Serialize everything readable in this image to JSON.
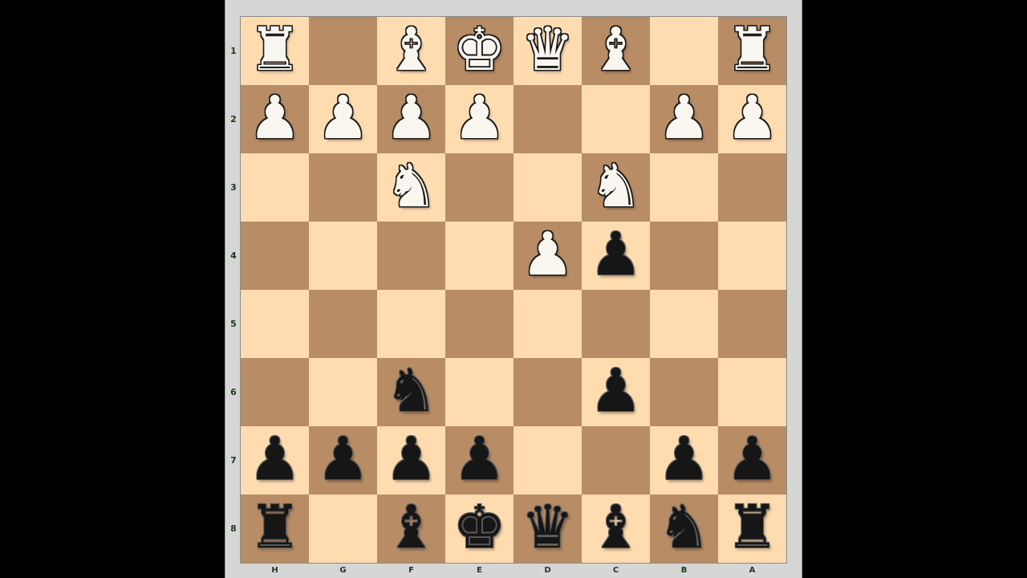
{
  "board": {
    "files": [
      "H",
      "G",
      "F",
      "E",
      "D",
      "C",
      "B",
      "A"
    ],
    "ranks": [
      "1",
      "2",
      "3",
      "4",
      "5",
      "6",
      "7",
      "8"
    ],
    "rows": [
      [
        "wr",
        "",
        "wb",
        "wk",
        "wq",
        "wb",
        "",
        "wr"
      ],
      [
        "wp",
        "wp",
        "wp",
        "wp",
        "",
        "",
        "wp",
        "wp"
      ],
      [
        "",
        "",
        "wn",
        "",
        "",
        "wn",
        "",
        ""
      ],
      [
        "",
        "",
        "",
        "",
        "wp",
        "bp",
        "",
        ""
      ],
      [
        "",
        "",
        "",
        "",
        "",
        "",
        "",
        ""
      ],
      [
        "",
        "",
        "bn",
        "",
        "",
        "bp",
        "",
        ""
      ],
      [
        "bp",
        "bp",
        "bp",
        "bp",
        "",
        "",
        "bp",
        "bp"
      ],
      [
        "br",
        "",
        "bb",
        "bk",
        "bq",
        "bb",
        "bn",
        "br"
      ]
    ],
    "first_square": "light"
  },
  "colors": {
    "light_square": "#fedcb0",
    "dark_square": "#b88c65",
    "frame": "#d6d6d6",
    "background": "#000000",
    "label": "#1c3a1c"
  },
  "piece_icons": {
    "k": "king-icon",
    "q": "queen-icon",
    "r": "rook-icon",
    "b": "bishop-icon",
    "n": "knight-icon",
    "p": "pawn-icon"
  }
}
